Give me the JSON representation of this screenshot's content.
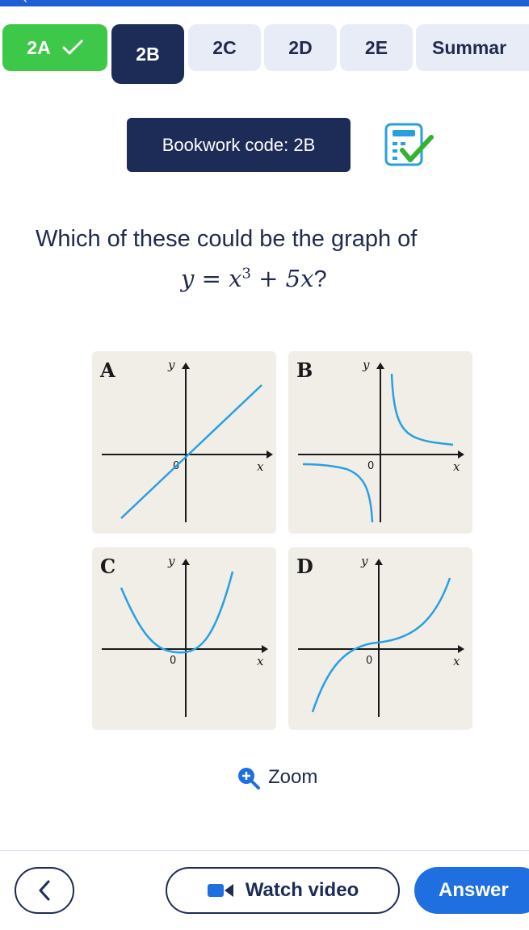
{
  "tabs": [
    {
      "label": "2A",
      "state": "done"
    },
    {
      "label": "2B",
      "state": "active"
    },
    {
      "label": "2C",
      "state": "todo"
    },
    {
      "label": "2D",
      "state": "todo"
    },
    {
      "label": "2E",
      "state": "todo"
    },
    {
      "label": "Summar",
      "state": "todo"
    }
  ],
  "bookwork": {
    "label": "Bookwork code: 2B"
  },
  "question": {
    "line1": "Which of these could be the graph of",
    "equation_lhs": "y = x",
    "equation_exp": "3",
    "equation_rhs": " + 5x",
    "equation_end": "?"
  },
  "graphs": {
    "axis_x": "x",
    "axis_y": "y",
    "origin": "0",
    "options": [
      {
        "label": "A"
      },
      {
        "label": "B"
      },
      {
        "label": "C"
      },
      {
        "label": "D"
      }
    ]
  },
  "zoom": {
    "label": "Zoom"
  },
  "footer": {
    "video_label": "Watch video",
    "answer_label": "Answer"
  },
  "colors": {
    "accent": "#1f6fe0",
    "navy": "#1d2b57",
    "done_green": "#3ec84a",
    "curve_blue": "#2a9fe0"
  }
}
